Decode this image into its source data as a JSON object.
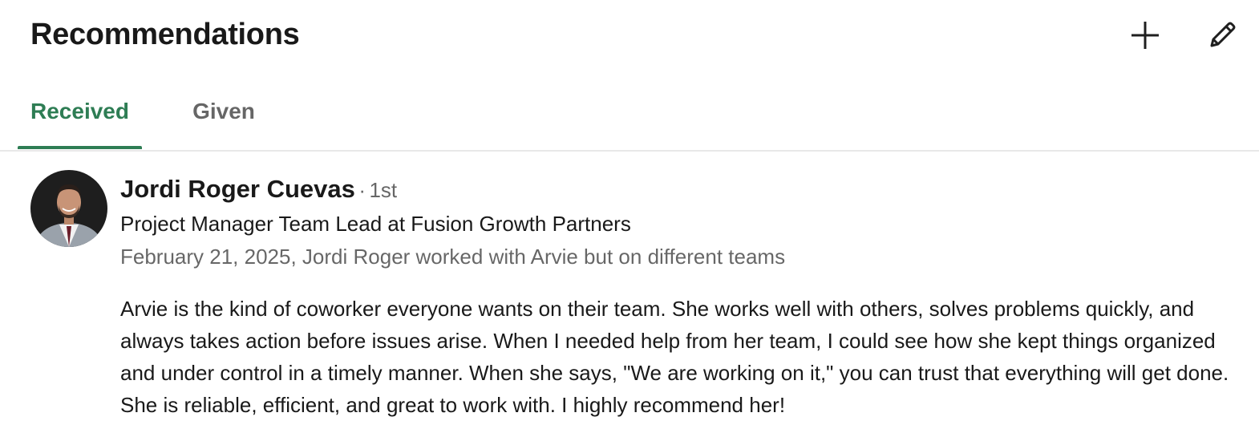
{
  "section": {
    "title": "Recommendations",
    "actions": {
      "add_icon": "plus-icon",
      "edit_icon": "pencil-icon"
    }
  },
  "tabs": [
    {
      "label": "Received",
      "selected": true
    },
    {
      "label": "Given",
      "selected": false
    }
  ],
  "recommendation": {
    "author_name": "Jordi Roger Cuevas",
    "separator": "·",
    "connection_degree": "1st",
    "headline": "Project Manager Team Lead at Fusion Growth Partners",
    "meta": "February 21, 2025, Jordi Roger worked with Arvie but on different teams",
    "text": "Arvie is the kind of coworker everyone wants on their team. She works well with others, solves problems quickly, and always takes action before issues arise. When I needed help from her team, I could see how she kept things organized and under control in a timely manner. When she says, \"We are working on it,\" you can trust that everything will get done. She is reliable, efficient, and great to work with. I highly recommend her!"
  },
  "colors": {
    "accent": "#2e7d54",
    "divider": "#e8e8e8",
    "text_primary": "#1f1f1f",
    "text_secondary": "#666666"
  }
}
